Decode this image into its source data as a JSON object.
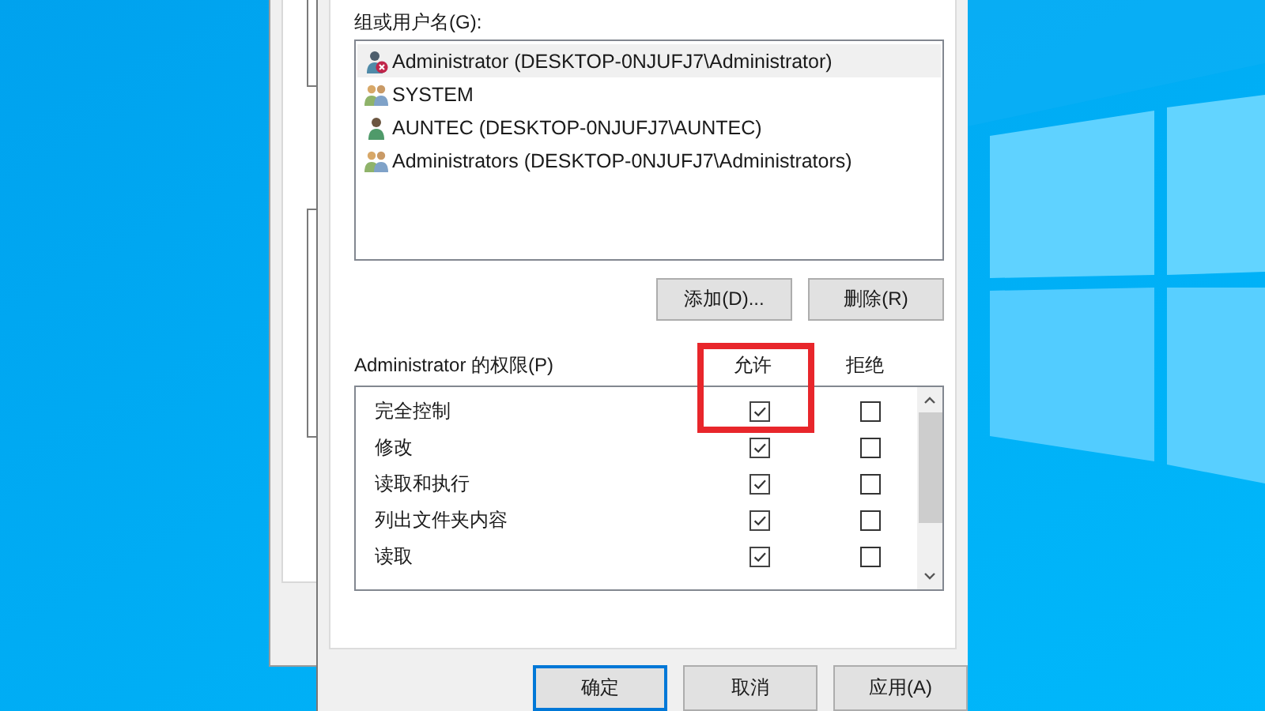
{
  "group_label": "组或用户名(G):",
  "users": [
    {
      "name": "Administrator (DESKTOP-0NJUFJ7\\Administrator)",
      "kind": "user-disabled",
      "selected": true
    },
    {
      "name": "SYSTEM",
      "kind": "group",
      "selected": false
    },
    {
      "name": "AUNTEC (DESKTOP-0NJUFJ7\\AUNTEC)",
      "kind": "user",
      "selected": false
    },
    {
      "name": "Administrators (DESKTOP-0NJUFJ7\\Administrators)",
      "kind": "group",
      "selected": false
    }
  ],
  "user_buttons": [
    "添加(D)...",
    "删除(R)"
  ],
  "permissions": {
    "label": "Administrator 的权限(P)",
    "allow_header": "允许",
    "deny_header": "拒绝",
    "rows": [
      {
        "name": "完全控制",
        "allow": true,
        "deny": false
      },
      {
        "name": "修改",
        "allow": true,
        "deny": false
      },
      {
        "name": "读取和执行",
        "allow": true,
        "deny": false
      },
      {
        "name": "列出文件夹内容",
        "allow": true,
        "deny": false
      },
      {
        "name": "读取",
        "allow": true,
        "deny": false
      }
    ]
  },
  "dialog_buttons": [
    {
      "label": "确定",
      "default": true
    },
    {
      "label": "取消",
      "default": false
    },
    {
      "label": "应用(A)",
      "default": false
    }
  ]
}
